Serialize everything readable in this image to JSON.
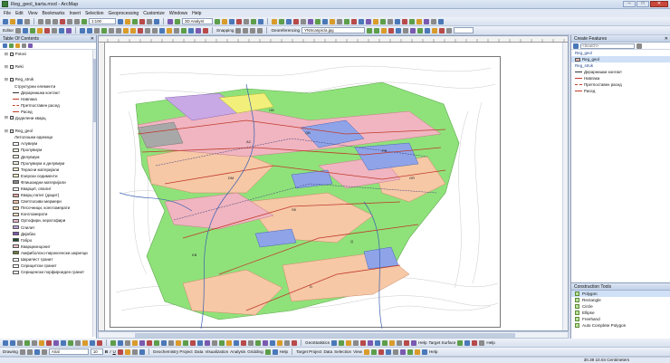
{
  "window": {
    "title": "Reg_geol_karta.mxd - ArcMap"
  },
  "menu": [
    "File",
    "Edit",
    "View",
    "Bookmarks",
    "Insert",
    "Selection",
    "Geoprocessing",
    "Customize",
    "Windows",
    "Help"
  ],
  "toolbar1": {
    "scale": "1:100",
    "analyst": "3D Analyst"
  },
  "toolbar2": {
    "editor": "Editor",
    "snapping": "Snapping",
    "georeferencing": "Georeferencing",
    "layer": "YNScanpic/a.jpg"
  },
  "toc": {
    "title": "Table Of Contents",
    "items": [
      {
        "label": "Potoci",
        "kind": "layer"
      },
      {
        "label": "",
        "kind": "blank"
      },
      {
        "label": "Reki",
        "kind": "layer"
      },
      {
        "label": "",
        "kind": "blank"
      },
      {
        "label": "Reg_struk",
        "kind": "layer"
      },
      {
        "label": "Структурни елементи",
        "kind": "text"
      },
      {
        "label": "Дерарнишки контакт",
        "kind": "line"
      },
      {
        "label": "Навлака",
        "kind": "line"
      },
      {
        "label": "Претпоставен расед",
        "kind": "line-dash"
      },
      {
        "label": "Расед",
        "kind": "line"
      },
      {
        "label": "Доделени кварц",
        "kind": "layer"
      },
      {
        "label": "",
        "kind": "blank"
      },
      {
        "label": "Reg_geol",
        "kind": "layer"
      },
      {
        "label": "Литолошки единици",
        "kind": "text"
      },
      {
        "label": "Алувиум",
        "kind": "swatch",
        "color": "#ffffff"
      },
      {
        "label": "Пролувиум",
        "kind": "swatch",
        "color": "#f7f7e8"
      },
      {
        "label": "Делувиум",
        "kind": "swatch",
        "color": "#f1efe0"
      },
      {
        "label": "Пролувиум и делувиум",
        "kind": "swatch",
        "color": "#eeeede"
      },
      {
        "label": "Терасни материјали",
        "kind": "swatch",
        "color": "#f4ecd6"
      },
      {
        "label": "Езерски седименти",
        "kind": "swatch",
        "color": "#f5f0c8"
      },
      {
        "label": "Флишоидни материјали",
        "kind": "swatch",
        "color": "#8a8a8a"
      },
      {
        "label": "Кварцит, опалит",
        "kind": "swatch",
        "color": "#ffffff"
      },
      {
        "label": "Кварц-латит (дацит)",
        "kind": "swatch",
        "color": "#e3a9a0"
      },
      {
        "label": "Светлосиви мермери",
        "kind": "swatch",
        "color": "#f3c2a4"
      },
      {
        "label": "Песочници, конгломерати",
        "kind": "swatch",
        "color": "#f6d7b8"
      },
      {
        "label": "Конгломерати",
        "kind": "swatch",
        "color": "#f6e0c0"
      },
      {
        "label": "Ортофири, кератофири",
        "kind": "swatch",
        "color": "#e9b7d0"
      },
      {
        "label": "Спилит",
        "kind": "swatch",
        "color": "#bfa2d9"
      },
      {
        "label": "Дијабаз",
        "kind": "swatch",
        "color": "#7e57b5"
      },
      {
        "label": "Габро",
        "kind": "swatch",
        "color": "#1e4e2a"
      },
      {
        "label": "Кварцмонцонит",
        "kind": "swatch",
        "color": "#f1c6cb"
      },
      {
        "label": "Амфиболско-пироксенски шкрилци",
        "kind": "swatch",
        "color": "#6a7e3d"
      },
      {
        "label": "Шкрилест гранит",
        "kind": "swatch",
        "color": "#ffffff"
      },
      {
        "label": "Серицитски гранит",
        "kind": "swatch",
        "color": "#ffffff"
      },
      {
        "label": "Сериценски порфироиден гранит",
        "kind": "swatch",
        "color": "#ffffff"
      }
    ]
  },
  "map": {
    "colors": {
      "green": "#8fe27a",
      "pink": "#f0b5c0",
      "salmon": "#f6c8a6",
      "blue": "#8fa4e8",
      "purple": "#c9a8e6",
      "yellow": "#f2f07a",
      "gray": "#a8a8a8"
    },
    "labels": [
      "OB",
      "QB",
      "PB",
      "DM",
      "SK",
      "Q",
      "KB",
      "D",
      "GR",
      "AC"
    ]
  },
  "create_features": {
    "title": "Create Features",
    "search_placeholder": "<Search>",
    "templates": [
      {
        "label": "Reg_geol",
        "kind": "header"
      },
      {
        "label": "Reg_geol",
        "kind": "swatch",
        "selected": true
      },
      {
        "label": "Reg_struk",
        "kind": "header"
      },
      {
        "label": "Дерарнишки контакт",
        "kind": "line-black"
      },
      {
        "label": "Навлака",
        "kind": "line"
      },
      {
        "label": "Претпоставен расед",
        "kind": "line-dash"
      },
      {
        "label": "Расед",
        "kind": "line"
      }
    ]
  },
  "construction_tools": {
    "title": "Construction Tools",
    "items": [
      {
        "label": "Polygon",
        "selected": true
      },
      {
        "label": "Rectangle"
      },
      {
        "label": "Circle"
      },
      {
        "label": "Ellipse"
      },
      {
        "label": "Freehand"
      },
      {
        "label": "Auto Complete Polygon"
      }
    ]
  },
  "bottom_toolbar1": {
    "geostats": "GeoStatistics",
    "help": "Help",
    "target_surface": "Target Surface",
    "help2": "Help"
  },
  "bottom_toolbar2": {
    "drawing": "Drawing",
    "font": "Arial",
    "font_size": "10",
    "geochem": "Geochemistry Project",
    "data": "Data",
    "visualization": "Visualization",
    "analysis": "Analysis",
    "gridding": "Gridding",
    "help": "Help",
    "target_project": "Target Project",
    "data2": "Data",
    "selection": "Selection",
    "view": "View",
    "help2": "Help"
  },
  "status": {
    "coords": "30.39  10.04 Centimeters"
  }
}
